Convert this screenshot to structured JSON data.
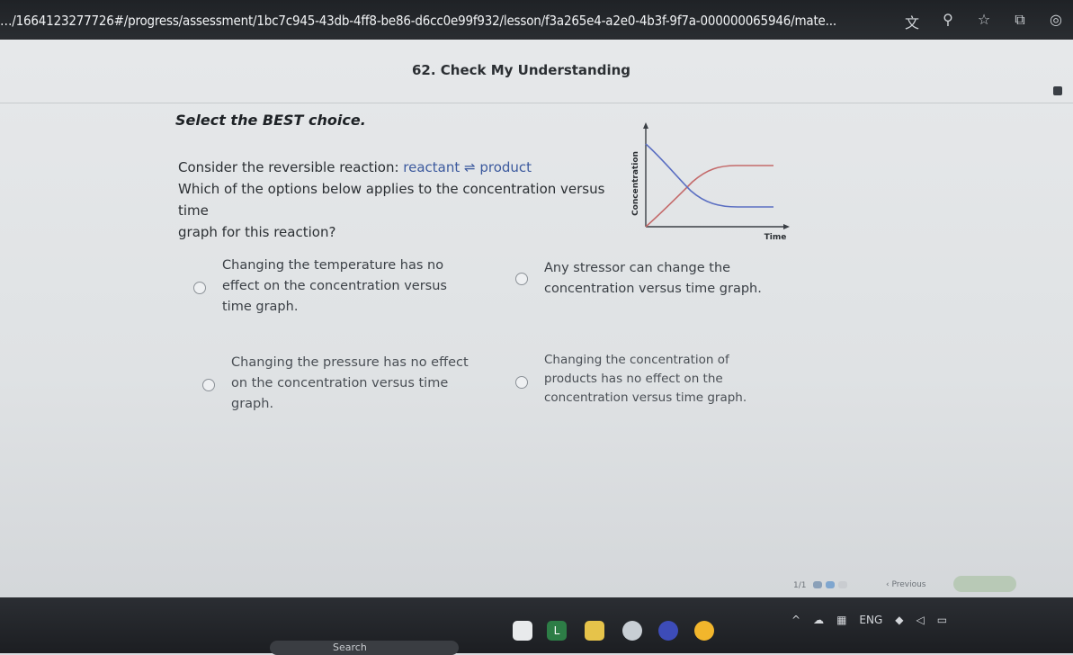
{
  "browser": {
    "url": "…/1664123277726#/progress/assessment/1bc7c945-43db-4ff8-be86-d6cc0e99f932/lesson/f3a265e4-a2e0-4b3f-9f7a-000000065946/mate...",
    "icons": [
      "translate-icon",
      "zoom-icon",
      "bookmark-star-icon",
      "extensions-icon",
      "profile-icon"
    ]
  },
  "lesson": {
    "title": "62. Check My Understanding",
    "instruction": "Select the BEST choice.",
    "question_line1_prefix": "Consider the reversible reaction:",
    "question_line1_reaction": "reactant ⇌ product",
    "question_line2": "Which of the options below applies to the concentration versus time",
    "question_line3": "graph for this reaction?"
  },
  "graph": {
    "ylabel": "Concentration",
    "xlabel": "Time"
  },
  "options": [
    {
      "text": "Changing the temperature has no effect on the concentration versus time graph.",
      "lines": [
        "Changing the temperature has no",
        "effect on the concentration versus",
        "time graph."
      ]
    },
    {
      "text": "Any stressor can change the concentration versus time graph.",
      "lines": [
        "Any stressor can change the",
        "concentration versus time graph."
      ]
    },
    {
      "text": "Changing the pressure has no effect on the concentration versus time graph.",
      "lines": [
        "Changing the pressure has no effect",
        "on the concentration versus time",
        "graph."
      ]
    },
    {
      "text": "Changing the concentration of products has no effect on the concentration versus time graph.",
      "lines": [
        "Changing the concentration of",
        "products has no effect on the",
        "concentration versus time graph."
      ]
    }
  ],
  "nav": {
    "page_count": "1/1",
    "previous_label": "‹ Previous"
  },
  "taskbar": {
    "search_label": "Search",
    "language": "ENG"
  },
  "colors": {
    "reactant_curve": "#5b6fc2",
    "product_curve": "#c46a6a",
    "reaction_text": "#3c5a9e"
  }
}
